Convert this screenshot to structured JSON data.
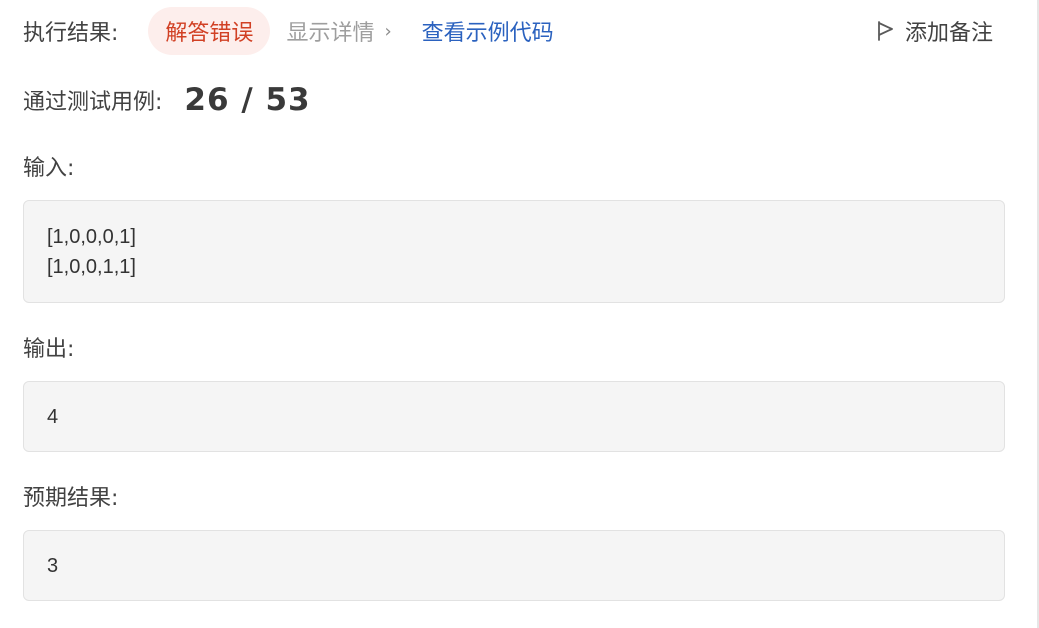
{
  "result": {
    "label": "执行结果:",
    "status": "解答错误",
    "detail_link": "显示详情",
    "detail_chevron": "›",
    "example_link": "查看示例代码",
    "note_button": "添加备注"
  },
  "pass": {
    "label": "通过测试用例:",
    "count": "26 / 53"
  },
  "input": {
    "label": "输入:",
    "lines": [
      "[1,0,0,0,1]",
      "[1,0,0,1,1]"
    ]
  },
  "output": {
    "label": "输出:",
    "value": "4"
  },
  "expected": {
    "label": "预期结果:",
    "value": "3"
  },
  "colors": {
    "error_text": "#d14024",
    "error_bg": "#fdeeec",
    "link": "#2b62bf",
    "box_bg": "#f5f5f5"
  },
  "icons": {
    "note": "flag-icon"
  }
}
